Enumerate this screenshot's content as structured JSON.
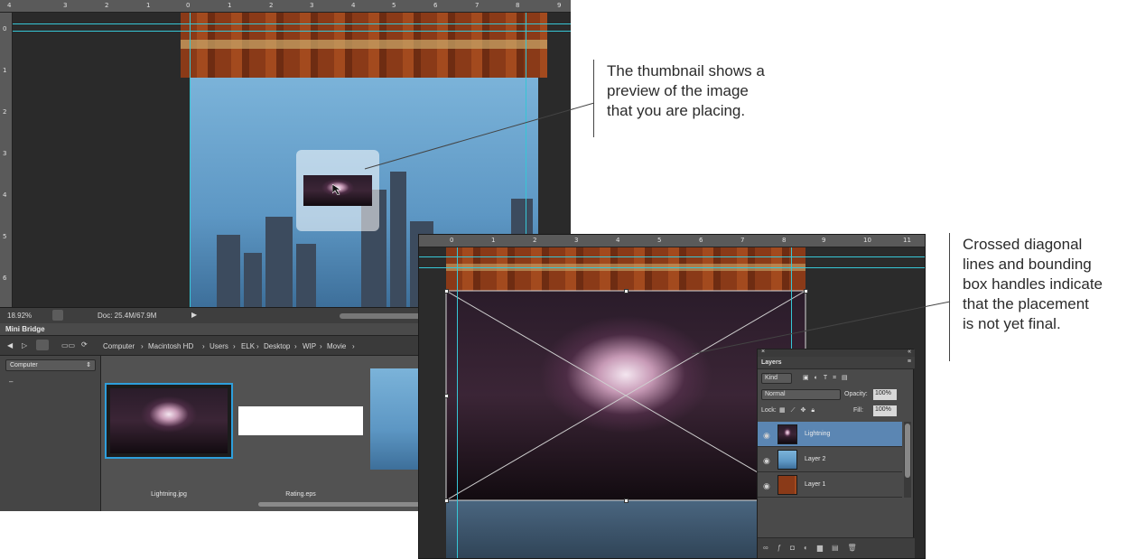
{
  "window1": {
    "ruler_h_ticks": [
      "4",
      "3",
      "2",
      "1",
      "0",
      "1",
      "2",
      "3",
      "4",
      "5",
      "6",
      "7",
      "8",
      "9"
    ],
    "ruler_v_ticks": [
      "0",
      "1",
      "2",
      "3",
      "4",
      "5",
      "6"
    ],
    "status": {
      "zoom": "18.92%",
      "doc": "Doc: 25.4M/67.9M"
    },
    "mini_bridge": {
      "tab": "Mini Bridge",
      "breadcrumb": [
        "Computer",
        "Macintosh HD",
        "Users",
        "ELK",
        "Desktop",
        "WIP",
        "Movie"
      ],
      "location_dropdown": "Computer",
      "files": [
        {
          "name": "Lightning.jpg",
          "selected": true
        },
        {
          "name": "Rating.eps",
          "selected": false
        }
      ]
    }
  },
  "window2": {
    "ruler_h_ticks": [
      "0",
      "1",
      "2",
      "3",
      "4",
      "5",
      "6",
      "7",
      "8",
      "9",
      "10",
      "11"
    ],
    "layers_panel": {
      "title": "Layers",
      "filter_kind": "Kind",
      "blend_mode": "Normal",
      "opacity_label": "Opacity:",
      "opacity_value": "100%",
      "lock_label": "Lock:",
      "fill_label": "Fill:",
      "fill_value": "100%",
      "layers": [
        {
          "name": "Lightning",
          "selected": true
        },
        {
          "name": "Layer 2",
          "selected": false
        },
        {
          "name": "Layer 1",
          "selected": false
        }
      ]
    }
  },
  "annotations": {
    "thumbnail": [
      "The thumbnail shows a",
      "preview of the image",
      "that you are placing."
    ],
    "placement": [
      "Crossed diagonal",
      "lines and bounding",
      "box handles indicate",
      "that the placement",
      "is not yet final."
    ]
  },
  "colors": {
    "guide": "#36c6d6",
    "selection": "#2e9fdc",
    "selected_layer": "#5b86b3"
  }
}
